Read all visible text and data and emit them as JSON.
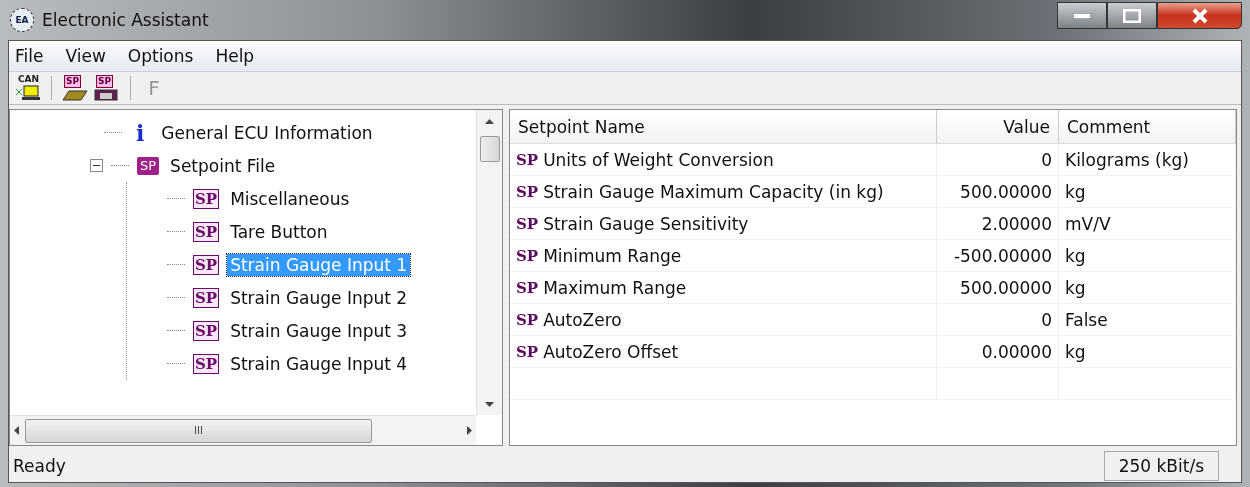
{
  "window": {
    "title": "Electronic Assistant",
    "app_icon": "EA"
  },
  "menu": [
    "File",
    "View",
    "Options",
    "Help"
  ],
  "toolbar": [
    {
      "kind": "can",
      "label": "CAN",
      "disabled": false
    },
    {
      "kind": "open",
      "label": "SP",
      "disabled": false
    },
    {
      "kind": "save",
      "label": "SP",
      "disabled": false
    },
    {
      "kind": "text",
      "label": "F",
      "disabled": true
    }
  ],
  "tree": {
    "items": [
      {
        "icon": "i",
        "kind": "info",
        "label": "General ECU Information",
        "selected": false
      },
      {
        "icon": "SP",
        "kind": "file",
        "label": "Setpoint File",
        "selected": false,
        "expanded": true,
        "children": [
          {
            "icon": "SP",
            "kind": "sp",
            "label": "Miscellaneous",
            "selected": false
          },
          {
            "icon": "SP",
            "kind": "sp",
            "label": "Tare Button",
            "selected": false
          },
          {
            "icon": "SP",
            "kind": "sp",
            "label": "Strain Gauge Input 1",
            "selected": true
          },
          {
            "icon": "SP",
            "kind": "sp",
            "label": "Strain Gauge Input 2",
            "selected": false
          },
          {
            "icon": "SP",
            "kind": "sp",
            "label": "Strain Gauge Input 3",
            "selected": false
          },
          {
            "icon": "SP",
            "kind": "sp",
            "label": "Strain Gauge Input 4",
            "selected": false
          }
        ]
      }
    ],
    "hscroll_grip": "III"
  },
  "table": {
    "columns": [
      "Setpoint Name",
      "Value",
      "Comment"
    ],
    "rows": [
      {
        "icon": "SP",
        "name": "Units of Weight Conversion",
        "value": "0",
        "comment": "Kilograms (kg)"
      },
      {
        "icon": "SP",
        "name": "Strain Gauge Maximum Capacity (in kg)",
        "value": "500.00000",
        "comment": "kg"
      },
      {
        "icon": "SP",
        "name": "Strain Gauge Sensitivity",
        "value": "2.00000",
        "comment": "mV/V"
      },
      {
        "icon": "SP",
        "name": "Minimum Range",
        "value": "-500.00000",
        "comment": "kg"
      },
      {
        "icon": "SP",
        "name": "Maximum Range",
        "value": "500.00000",
        "comment": "kg"
      },
      {
        "icon": "SP",
        "name": "AutoZero",
        "value": "0",
        "comment": "False"
      },
      {
        "icon": "SP",
        "name": "AutoZero Offset",
        "value": "0.00000",
        "comment": "kg"
      }
    ]
  },
  "status_bar": {
    "text": "Ready",
    "baud": "250 kBit/s"
  }
}
